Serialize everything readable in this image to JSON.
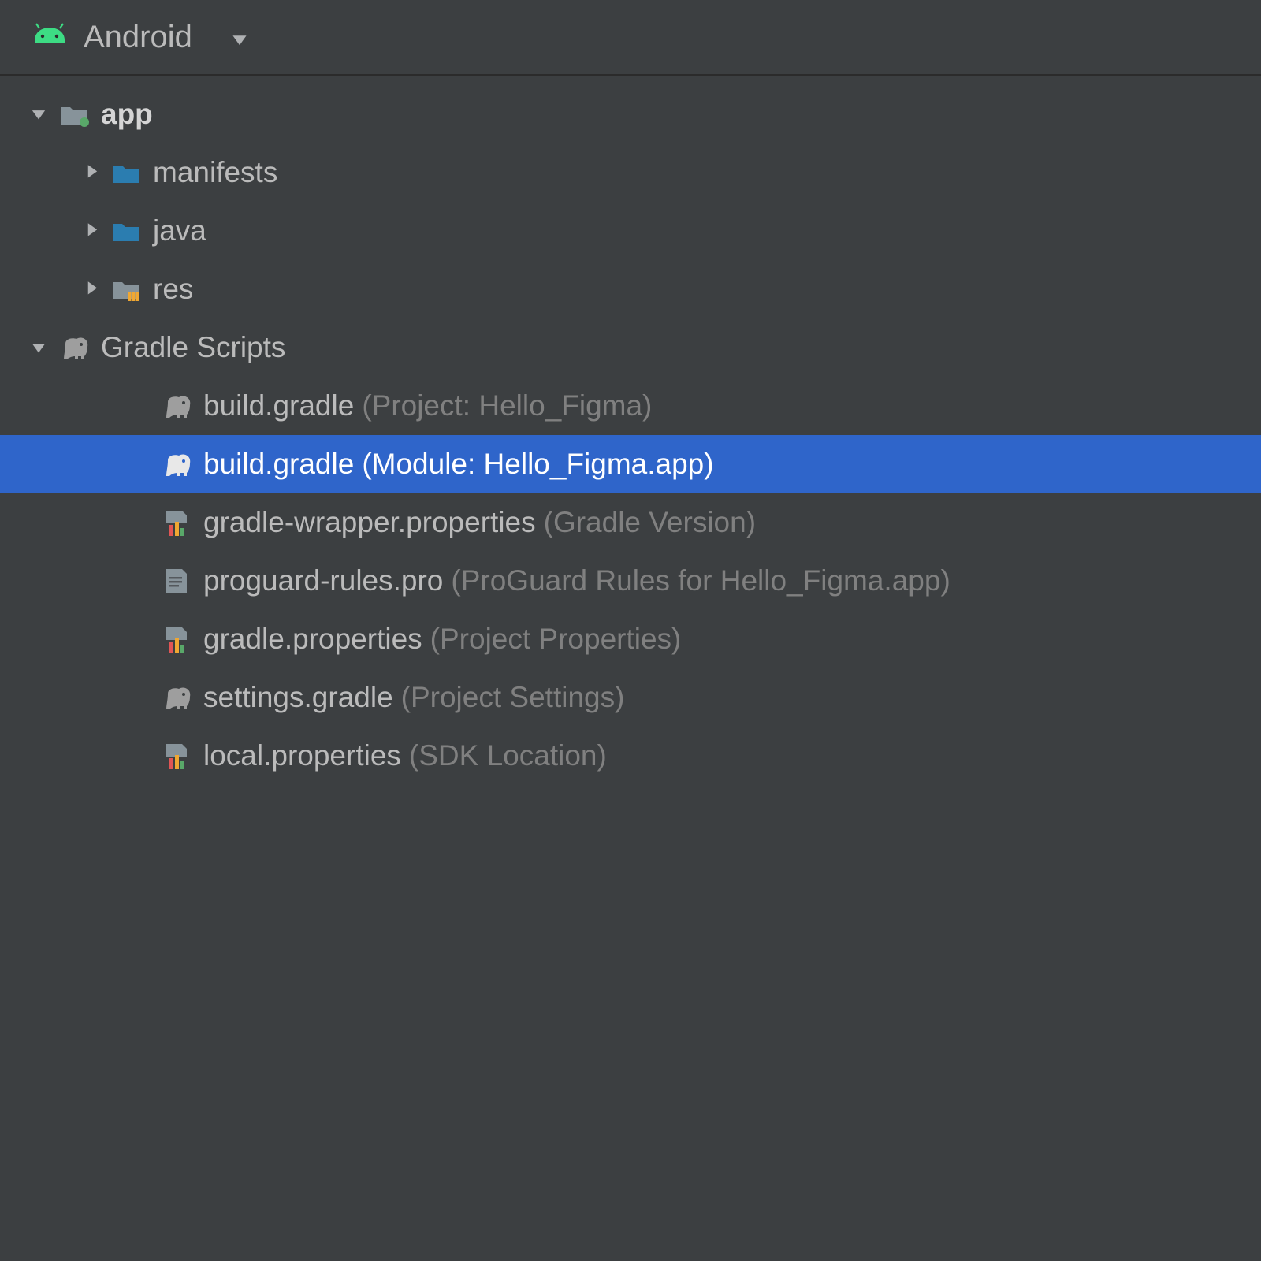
{
  "header": {
    "view": "Android"
  },
  "tree": {
    "app": {
      "label": "app",
      "children": {
        "manifests": "manifests",
        "java": "java",
        "res": "res"
      }
    },
    "gradle": {
      "label": "Gradle Scripts",
      "files": [
        {
          "name": "build.gradle",
          "annotation": "(Project: Hello_Figma)",
          "icon": "elephant",
          "selected": false
        },
        {
          "name": "build.gradle",
          "annotation": "(Module: Hello_Figma.app)",
          "icon": "elephant",
          "selected": true
        },
        {
          "name": "gradle-wrapper.properties",
          "annotation": "(Gradle Version)",
          "icon": "props",
          "selected": false
        },
        {
          "name": "proguard-rules.pro",
          "annotation": "(ProGuard Rules for Hello_Figma.app)",
          "icon": "textfile",
          "selected": false
        },
        {
          "name": "gradle.properties",
          "annotation": "(Project Properties)",
          "icon": "props",
          "selected": false
        },
        {
          "name": "settings.gradle",
          "annotation": "(Project Settings)",
          "icon": "elephant",
          "selected": false
        },
        {
          "name": "local.properties",
          "annotation": "(SDK Location)",
          "icon": "props",
          "selected": false
        }
      ]
    }
  }
}
